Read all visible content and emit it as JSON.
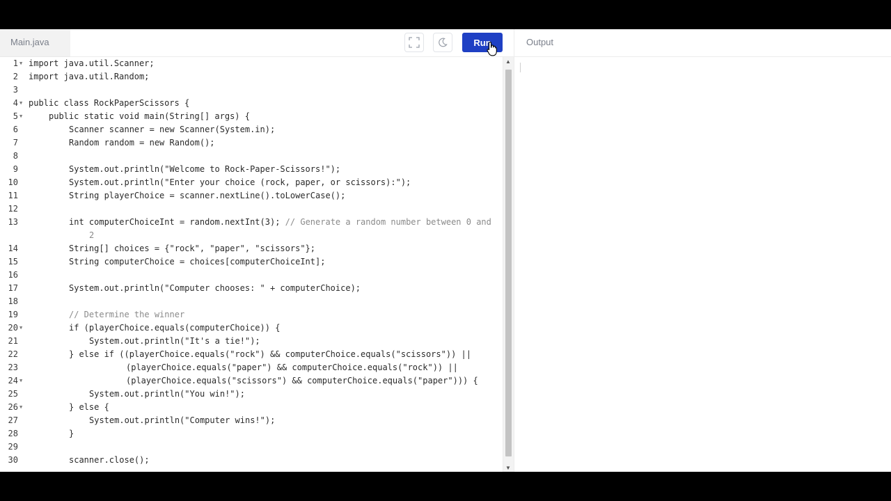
{
  "file_tab": {
    "name": "Main.java"
  },
  "toolbar": {
    "run_label": "Run"
  },
  "output": {
    "title": "Output"
  },
  "editor": {
    "lines": [
      {
        "n": "1",
        "indent": 0,
        "fold": true,
        "code": "import java.util.Scanner;"
      },
      {
        "n": "2",
        "indent": 0,
        "fold": false,
        "code": "import java.util.Random;"
      },
      {
        "n": "3",
        "indent": 0,
        "fold": false,
        "code": ""
      },
      {
        "n": "4",
        "indent": 0,
        "fold": true,
        "code": "public class RockPaperScissors {"
      },
      {
        "n": "5",
        "indent": 1,
        "fold": true,
        "code": "public static void main(String[] args) {"
      },
      {
        "n": "6",
        "indent": 2,
        "fold": false,
        "code": "Scanner scanner = new Scanner(System.in);"
      },
      {
        "n": "7",
        "indent": 2,
        "fold": false,
        "code": "Random random = new Random();"
      },
      {
        "n": "8",
        "indent": 0,
        "fold": false,
        "code": ""
      },
      {
        "n": "9",
        "indent": 2,
        "fold": false,
        "code": "System.out.println(\"Welcome to Rock-Paper-Scissors!\");"
      },
      {
        "n": "10",
        "indent": 2,
        "fold": false,
        "code": "System.out.println(\"Enter your choice (rock, paper, or scissors):\");"
      },
      {
        "n": "11",
        "indent": 2,
        "fold": false,
        "code": "String playerChoice = scanner.nextLine().toLowerCase();"
      },
      {
        "n": "12",
        "indent": 0,
        "fold": false,
        "code": ""
      },
      {
        "n": "13",
        "indent": 2,
        "fold": false,
        "code": "int computerChoiceInt = random.nextInt(3); ",
        "comment": "// Generate a random number between 0 and",
        "wrap": "2"
      },
      {
        "n": "14",
        "indent": 2,
        "fold": false,
        "code": "String[] choices = {\"rock\", \"paper\", \"scissors\"};"
      },
      {
        "n": "15",
        "indent": 2,
        "fold": false,
        "code": "String computerChoice = choices[computerChoiceInt];"
      },
      {
        "n": "16",
        "indent": 0,
        "fold": false,
        "code": ""
      },
      {
        "n": "17",
        "indent": 2,
        "fold": false,
        "code": "System.out.println(\"Computer chooses: \" + computerChoice);"
      },
      {
        "n": "18",
        "indent": 0,
        "fold": false,
        "code": ""
      },
      {
        "n": "19",
        "indent": 2,
        "fold": false,
        "code": "",
        "comment": "// Determine the winner"
      },
      {
        "n": "20",
        "indent": 2,
        "fold": true,
        "code": "if (playerChoice.equals(computerChoice)) {"
      },
      {
        "n": "21",
        "indent": 3,
        "fold": false,
        "code": "System.out.println(\"It's a tie!\");"
      },
      {
        "n": "22",
        "indent": 2,
        "fold": false,
        "code": "} else if ((playerChoice.equals(\"rock\") && computerChoice.equals(\"scissors\")) ||"
      },
      {
        "n": "23",
        "indent": 5,
        "fold": false,
        "code": "(playerChoice.equals(\"paper\") && computerChoice.equals(\"rock\")) ||"
      },
      {
        "n": "24",
        "indent": 5,
        "fold": true,
        "code": "(playerChoice.equals(\"scissors\") && computerChoice.equals(\"paper\"))) {"
      },
      {
        "n": "25",
        "indent": 3,
        "fold": false,
        "code": "System.out.println(\"You win!\");"
      },
      {
        "n": "26",
        "indent": 2,
        "fold": true,
        "code": "} else {"
      },
      {
        "n": "27",
        "indent": 3,
        "fold": false,
        "code": "System.out.println(\"Computer wins!\");"
      },
      {
        "n": "28",
        "indent": 2,
        "fold": false,
        "code": "}"
      },
      {
        "n": "29",
        "indent": 0,
        "fold": false,
        "code": ""
      },
      {
        "n": "30",
        "indent": 2,
        "fold": false,
        "code": "scanner.close();"
      }
    ]
  },
  "icons": {
    "fullscreen": "fullscreen-icon",
    "theme": "moon-icon",
    "cursor": "pointer-hand-icon"
  },
  "colors": {
    "run_button": "#1f40c4",
    "comment": "#8a8a8a"
  }
}
